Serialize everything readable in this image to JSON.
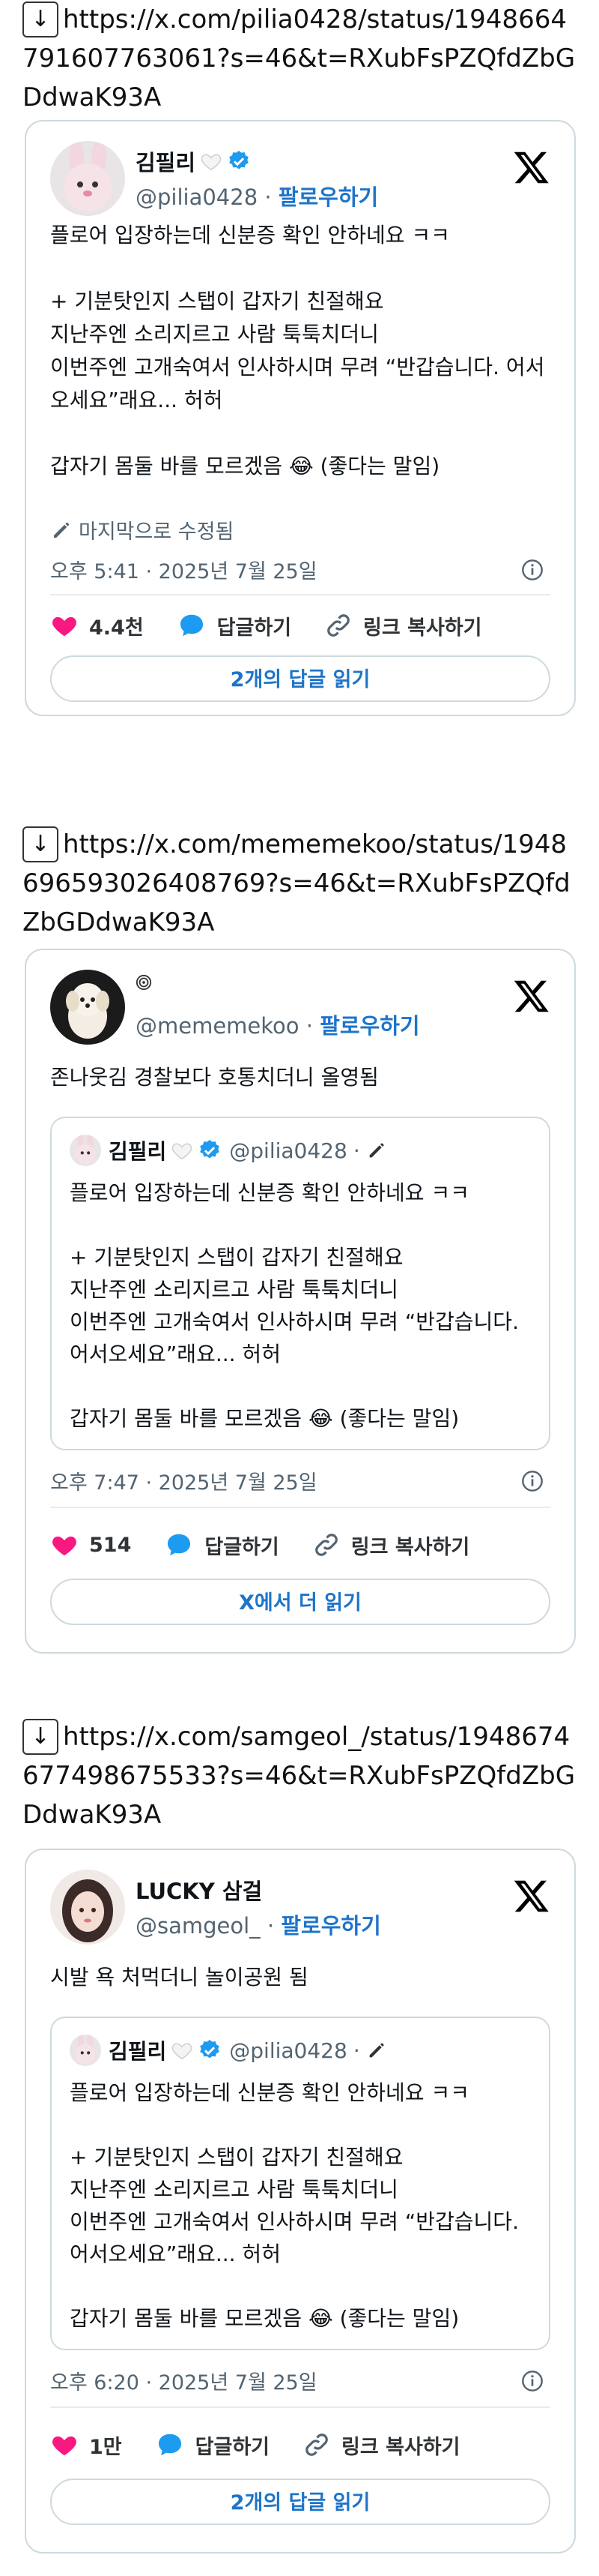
{
  "posts": [
    {
      "url": "https://x.com/pilia0428/status/1948664791607763061?s=46&t=RXubFsPZQfdZbGDdwaK93A",
      "author_name": "김필리",
      "handle": "@pilia0428",
      "follow_label": "팔로우하기",
      "text": "플로어 입장하는데 신분증 확인 안하네요 ㅋㅋ\n\n+ 기분탓인지 스탭이 갑자기 친절해요\n지난주엔 소리지르고 사람 툭툭치더니\n이번주엔 고개숙여서 인사하시며 무려 “반갑습니다. 어서오세요”래요... 허허\n\n갑자기 몸둘 바를 모르겠음 😂 (좋다는 말임)",
      "edited_label": "마지막으로 수정됨",
      "timestamp": "오후 5:41 · 2025년 7월 25일",
      "likes": "4.4천",
      "reply_label": "답글하기",
      "copy_link_label": "링크 복사하기",
      "cta_label": "2개의 답글 읽기"
    },
    {
      "url": "https://x.com/mememekoo/status/1948696593026408769?s=46&t=RXubFsPZQfdZbGDdwaK93A",
      "author_name": "",
      "handle": "@mememekoo",
      "follow_label": "팔로우하기",
      "text": "존나웃김 경찰보다 호통치더니 올영됨",
      "quote": {
        "author_name": "김필리",
        "handle": "@pilia0428",
        "text": "플로어 입장하는데 신분증 확인 안하네요 ㅋㅋ\n\n+ 기분탓인지 스탭이 갑자기 친절해요\n지난주엔 소리지르고 사람 툭툭치더니\n이번주엔 고개숙여서 인사하시며 무려 “반갑습니다. 어서오세요”래요... 허허\n\n갑자기 몸둘 바를 모르겠음 😂 (좋다는 말임)"
      },
      "timestamp": "오후 7:47 · 2025년 7월 25일",
      "likes": "514",
      "reply_label": "답글하기",
      "copy_link_label": "링크 복사하기",
      "cta_label": "X에서 더 읽기"
    },
    {
      "url": "https://x.com/samgeol_/status/1948674677498675533?s=46&t=RXubFsPZQfdZbGDdwaK93A",
      "author_name": "LUCKY 삼걸",
      "handle": "@samgeol_",
      "follow_label": "팔로우하기",
      "text": "시발 욕 처먹더니 놀이공원 됨",
      "quote": {
        "author_name": "김필리",
        "handle": "@pilia0428",
        "text": "플로어 입장하는데 신분증 확인 안하네요 ㅋㅋ\n\n+ 기분탓인지 스탭이 갑자기 친절해요\n지난주엔 소리지르고 사람 툭툭치더니\n이번주엔 고개숙여서 인사하시며 무려 “반갑습니다. 어서오세요”래요... 허허\n\n갑자기 몸둘 바를 모르겠음 😂 (좋다는 말임)"
      },
      "timestamp": "오후 6:20 · 2025년 7월 25일",
      "likes": "1만",
      "reply_label": "답글하기",
      "copy_link_label": "링크 복사하기",
      "cta_label": "2개의 답글 읽기"
    }
  ],
  "colors": {
    "accent": "#1d74c9",
    "like": "#f91880",
    "reply": "#1d9bf0",
    "border": "#cfd9de",
    "muted": "#536471"
  },
  "icons": [
    "down-arrow-icon",
    "x-logo-icon",
    "verified-badge-icon",
    "white-heart-icon",
    "pencil-icon",
    "info-icon",
    "heart-icon",
    "reply-bubble-icon",
    "link-icon"
  ]
}
